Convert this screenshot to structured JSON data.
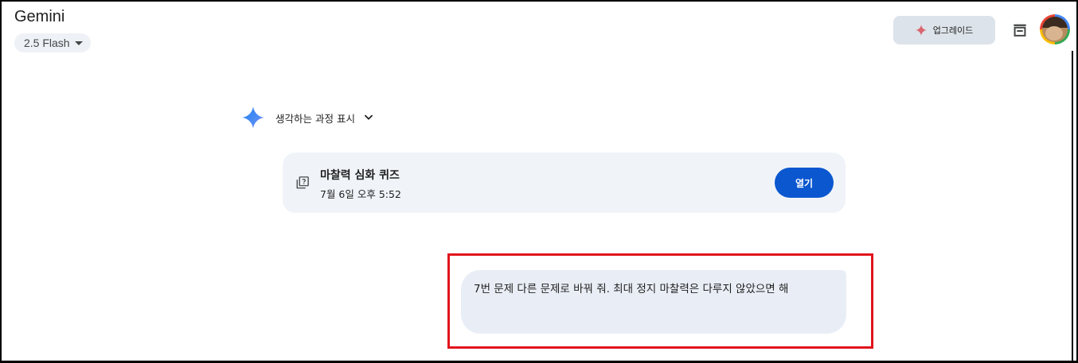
{
  "header": {
    "app_title": "Gemini",
    "model_label": "2.5 Flash",
    "upgrade_label": "업그레이드"
  },
  "colors": {
    "accent_blue": "#0b57d0",
    "chip_bg": "#eef1f6",
    "card_bg": "#f0f4f9",
    "bubble_bg": "#e9eef6",
    "upgrade_bg": "#dde3ea",
    "highlight_red": "#e0141c",
    "sparkle_red": "#d96570"
  },
  "icons": {
    "model_chip": "caret-down-icon",
    "upgrade": "sparkle-icon",
    "header_right": "archive-icon",
    "thoughts": "gemini-star-icon",
    "thoughts_toggle": "chevron-down-icon",
    "card": "quiz-icon"
  },
  "conversation": {
    "thoughts_toggle_label": "생각하는 과정 표시",
    "card": {
      "title": "마찰력 심화 퀴즈",
      "timestamp": "7월 6일 오후 5:52",
      "open_label": "열기"
    },
    "user_message": "7번 문제 다른 문제로 바꿔 줘. 최대 정지 마찰력은 다루지 않았으면 해"
  }
}
